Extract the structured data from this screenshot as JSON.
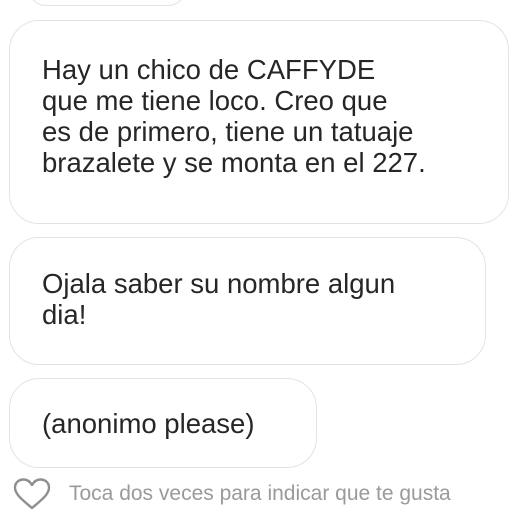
{
  "messages": [
    {
      "text": "Hay un chico de CAFFYDE\nque me tiene loco. Creo que\nes de primero, tiene un tatuaje\nbrazalete y se monta en el 227."
    },
    {
      "text": "Ojala saber su nombre algun\ndia!"
    },
    {
      "text": "(anonimo please)"
    }
  ],
  "footer": {
    "like_hint": "Toca dos veces para indicar que te gusta",
    "like_icon": "heart-outline-icon"
  },
  "colors": {
    "bubble_border": "#e3e3e3",
    "text": "#262626",
    "hint_text": "#9a9a9a"
  }
}
